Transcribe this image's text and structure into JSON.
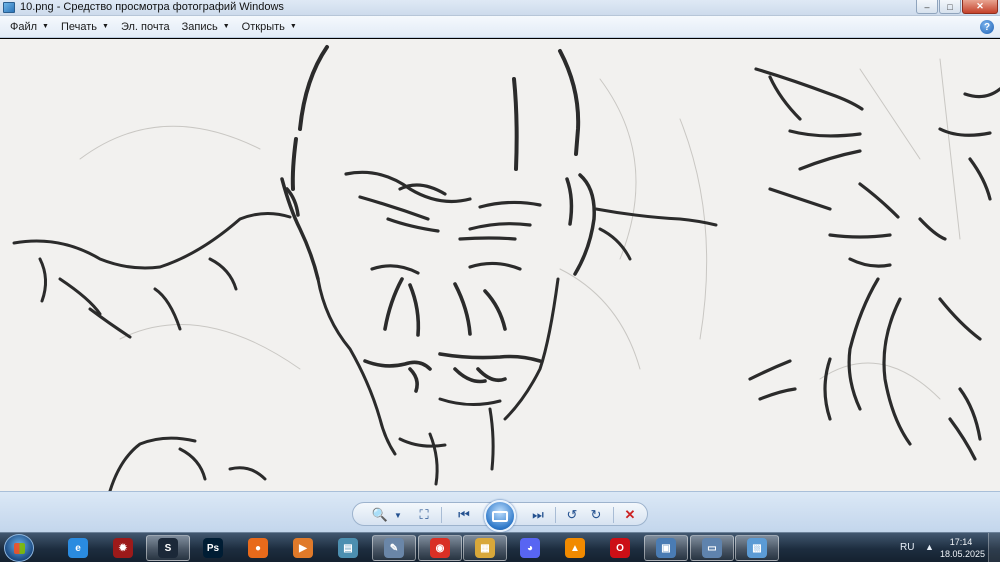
{
  "window": {
    "title": "10.png - Средство просмотра фотографий Windows",
    "controls": {
      "minimize": "–",
      "maximize": "□",
      "close": "✕"
    }
  },
  "menu": {
    "file": "Файл",
    "print": "Печать",
    "email": "Эл. почта",
    "burn": "Запись",
    "open": "Открыть",
    "help": "?"
  },
  "toolbar": {
    "zoom_icon": "zoom-icon",
    "fit_icon": "fit-icon",
    "prev_icon": "previous-icon",
    "slideshow_icon": "slideshow-icon",
    "next_icon": "next-icon",
    "rotate_ccw_icon": "rotate-ccw-icon",
    "rotate_cw_icon": "rotate-cw-icon",
    "delete_icon": "delete-icon"
  },
  "taskbar": {
    "apps": [
      {
        "name": "internet-explorer",
        "color": "#2a8be0",
        "glyph": "e"
      },
      {
        "name": "app-red-gear",
        "color": "#9c1a1a",
        "glyph": "✹"
      },
      {
        "name": "steam",
        "color": "#1b2838",
        "glyph": "S"
      },
      {
        "name": "photoshop",
        "color": "#001d34",
        "glyph": "Ps"
      },
      {
        "name": "firefox",
        "color": "#e86a1b",
        "glyph": "●"
      },
      {
        "name": "video-player",
        "color": "#e07a2a",
        "glyph": "▶"
      },
      {
        "name": "notes-app",
        "color": "#4c8fb0",
        "glyph": "▤"
      },
      {
        "name": "paint",
        "color": "#6a86a8",
        "glyph": "✎"
      },
      {
        "name": "chrome",
        "color": "#d93025",
        "glyph": "◉"
      },
      {
        "name": "file-explorer",
        "color": "#d9a83a",
        "glyph": "▦"
      },
      {
        "name": "discord",
        "color": "#5865f2",
        "glyph": "◕"
      },
      {
        "name": "vlc",
        "color": "#f18a00",
        "glyph": "▲"
      },
      {
        "name": "opera",
        "color": "#cc0f16",
        "glyph": "O"
      },
      {
        "name": "control-panel",
        "color": "#4a7cb4",
        "glyph": "▣"
      },
      {
        "name": "remote-desktop",
        "color": "#5f83ad",
        "glyph": "▭"
      },
      {
        "name": "photo-viewer",
        "color": "#5b9bd5",
        "glyph": "▧"
      }
    ],
    "language": "RU",
    "tray_arrow": "▲",
    "time": "17:14",
    "date": "18.05.2025"
  },
  "colors": {
    "canvas_bg": "#f2f1ef",
    "ink": "#2b2b2b"
  }
}
